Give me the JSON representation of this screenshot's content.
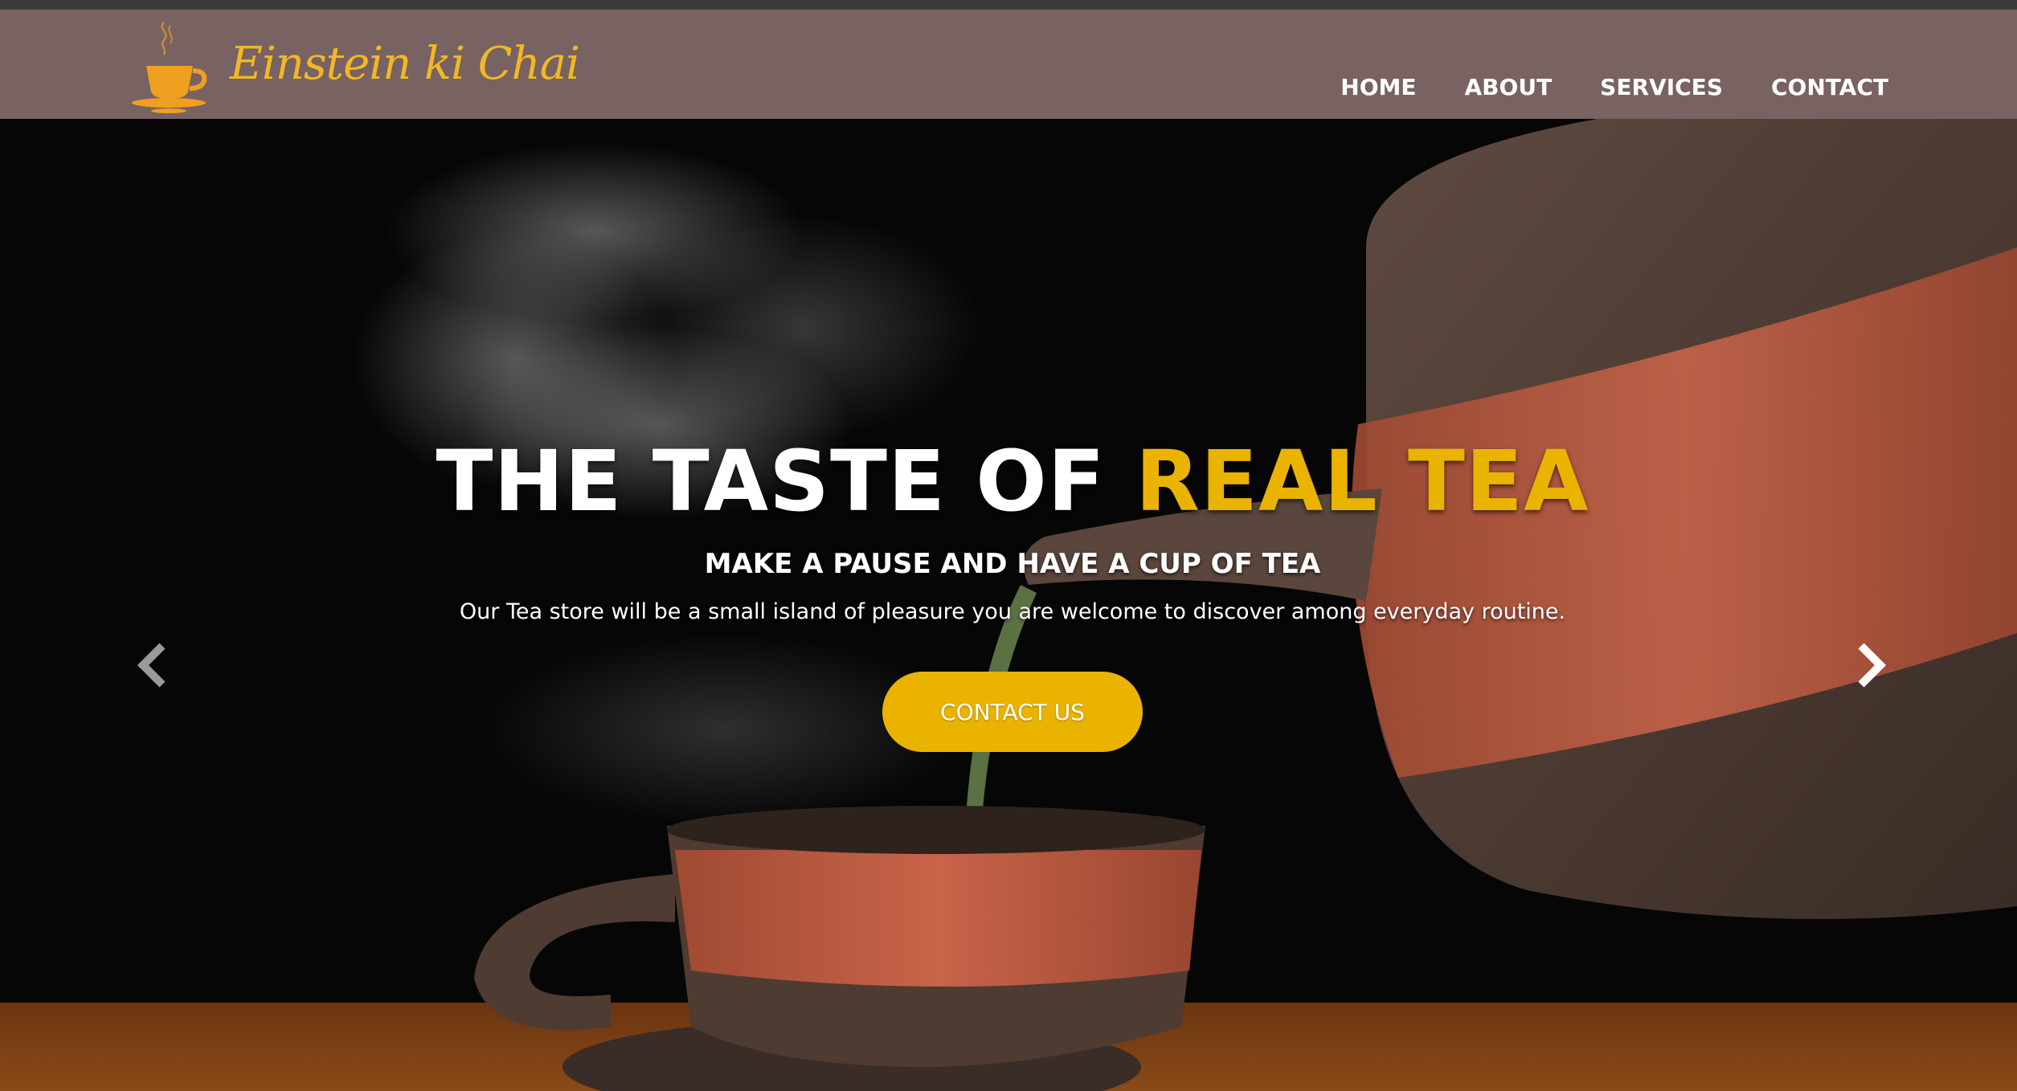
{
  "brand": {
    "name": "Einstein ki Chai",
    "logo_icon": "steaming-teacup-icon"
  },
  "nav": {
    "items": [
      {
        "label": "HOME"
      },
      {
        "label": "ABOUT"
      },
      {
        "label": "SERVICES"
      },
      {
        "label": "CONTACT"
      }
    ]
  },
  "hero": {
    "headline_white": "THE TASTE OF ",
    "headline_accent": "REAL TEA",
    "subheadline": "MAKE A PAUSE AND HAVE A CUP OF TEA",
    "description": "Our Tea store will be a small island of pleasure you are welcome to discover among everyday routine.",
    "cta_label": "CONTACT US",
    "prev_icon": "chevron-left-icon",
    "next_icon": "chevron-right-icon"
  },
  "colors": {
    "navbar": "#786262",
    "accent": "#e9b300",
    "brand_text": "#f0b824"
  }
}
